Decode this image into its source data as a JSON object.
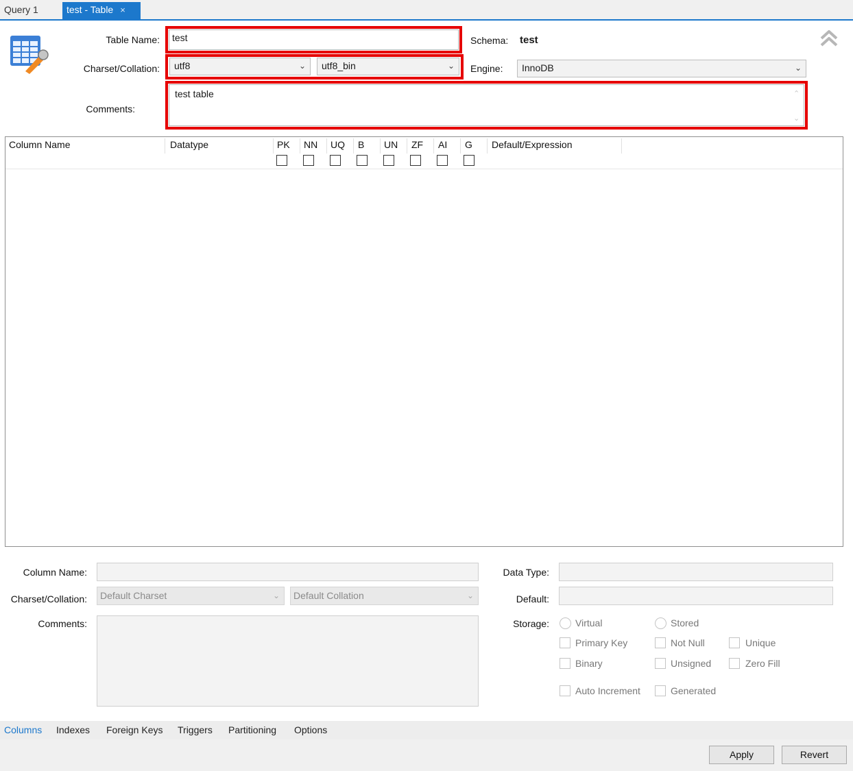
{
  "tabs": [
    {
      "label": "Query 1"
    },
    {
      "label": "test - Table",
      "close": "×"
    }
  ],
  "header": {
    "table_name_label": "Table Name:",
    "table_name_value": "test",
    "schema_label": "Schema:",
    "schema_value": "test",
    "charset_label": "Charset/Collation:",
    "charset_value": "utf8",
    "collation_value": "utf8_bin",
    "engine_label": "Engine:",
    "engine_value": "InnoDB",
    "comments_label": "Comments:",
    "comments_value": "test table"
  },
  "grid": {
    "columns": [
      "Column Name",
      "Datatype",
      "PK",
      "NN",
      "UQ",
      "B",
      "UN",
      "ZF",
      "AI",
      "G",
      "Default/Expression"
    ]
  },
  "column_form": {
    "column_name_label": "Column Name:",
    "charset_label": "Charset/Collation:",
    "charset_placeholder": "Default Charset",
    "collation_placeholder": "Default Collation",
    "comments_label": "Comments:",
    "data_type_label": "Data Type:",
    "default_label": "Default:",
    "storage_label": "Storage:",
    "storage_options": [
      "Virtual",
      "Stored"
    ],
    "flags": [
      "Primary Key",
      "Not Null",
      "Unique",
      "Binary",
      "Unsigned",
      "Zero Fill",
      "Auto Increment",
      "Generated"
    ]
  },
  "bottom_tabs": [
    "Columns",
    "Indexes",
    "Foreign Keys",
    "Triggers",
    "Partitioning",
    "Options"
  ],
  "buttons": {
    "apply": "Apply",
    "revert": "Revert"
  },
  "colors": {
    "accent": "#1c78cc",
    "highlight": "#e60000"
  },
  "icons": {
    "table": "table-edit-icon",
    "collapse": "double-chevron-up-icon"
  }
}
